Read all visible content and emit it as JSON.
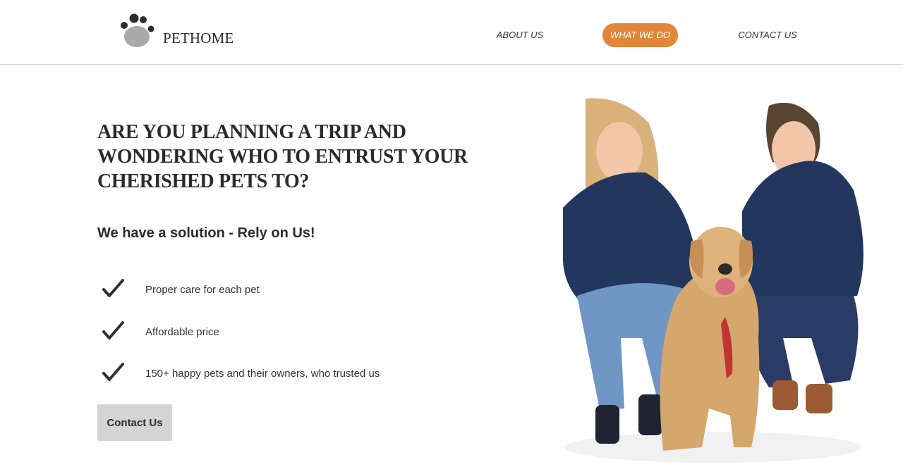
{
  "header": {
    "logo_text": "PETHOME",
    "nav": [
      {
        "label": "ABOUT US"
      },
      {
        "label": "WHAT WE DO",
        "active": true
      },
      {
        "label": "CONTACT US"
      }
    ],
    "accent_color": "#e0873a"
  },
  "hero": {
    "headline": "ARE YOU PLANNING A TRIP AND WONDERING WHO TO ENTRUST YOUR CHERISHED PETS TO?",
    "subheadline": "We have a solution - Rely on Us!",
    "features": [
      {
        "icon": "checkmark-icon",
        "text": "Proper care for each pet"
      },
      {
        "icon": "checkmark-icon",
        "text": "Affordable price"
      },
      {
        "icon": "checkmark-icon",
        "text": "150+ happy pets and their owners, who trusted us"
      }
    ],
    "cta_label": "Contact Us",
    "image": "two-women-with-dog-photo"
  }
}
